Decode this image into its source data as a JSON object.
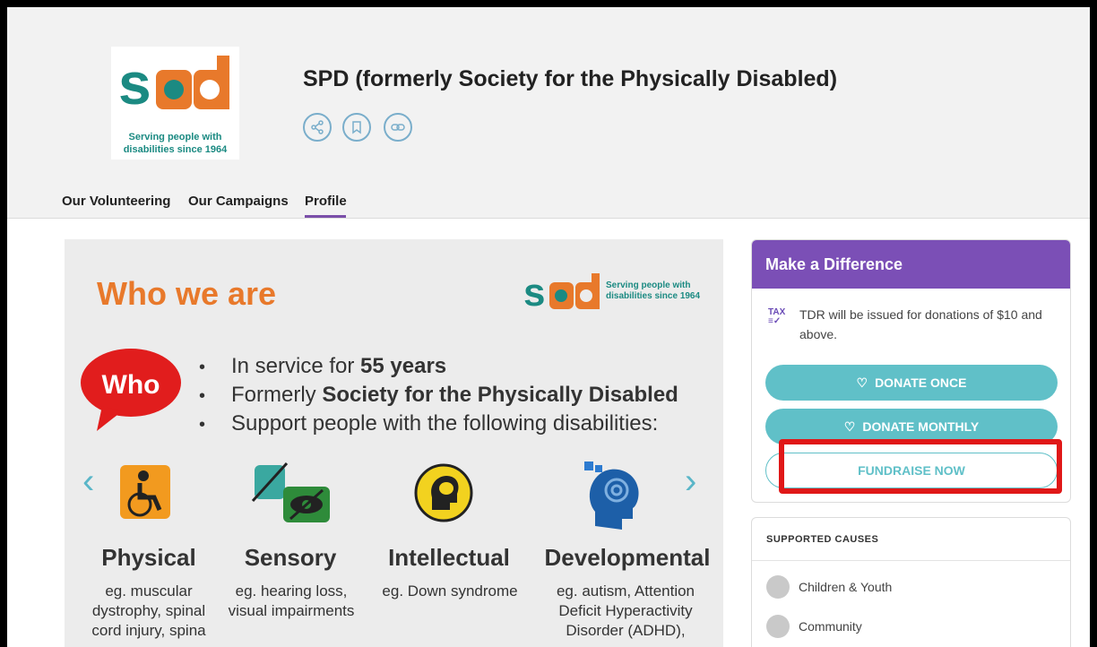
{
  "header": {
    "logo_word": "spd",
    "logo_tagline_1": "Serving people with",
    "logo_tagline_2": "disabilities since 1964",
    "title": "SPD (formerly Society for the Physically Disabled)",
    "actions": [
      "share-icon",
      "bookmark-icon",
      "link-icon"
    ]
  },
  "tabs": [
    {
      "label": "Our Volunteering"
    },
    {
      "label": "Our Campaigns"
    },
    {
      "label": "Profile",
      "active": true
    }
  ],
  "carousel": {
    "heading": "Who we are",
    "logo_tagline_1": "Serving people with",
    "logo_tagline_2": "disabilities since 1964",
    "who_label": "Who",
    "bullets": [
      {
        "prefix": "In service for ",
        "bold": "55 years"
      },
      {
        "prefix": "Formerly ",
        "bold": "Society for the Physically Disabled"
      },
      {
        "prefix": "Support people with the following disabilities:",
        "bold": ""
      }
    ],
    "prev_arrow": "‹",
    "next_arrow": "›",
    "categories": [
      {
        "title": "Physical",
        "desc": [
          "eg. muscular",
          "dystrophy, spinal",
          "cord injury, spina"
        ]
      },
      {
        "title": "Sensory",
        "desc": [
          "eg. hearing loss,",
          "visual impairments"
        ]
      },
      {
        "title": "Intellectual",
        "desc": [
          "eg. Down syndrome"
        ]
      },
      {
        "title": "Developmental",
        "desc": [
          "eg. autism, Attention",
          "Deficit Hyperactivity",
          "Disorder (ADHD),"
        ]
      }
    ]
  },
  "donate": {
    "heading": "Make a Difference",
    "tax_icon": "TAX",
    "tdr_text": "TDR will be issued for donations of $10 and above.",
    "donate_once": "DONATE ONCE",
    "donate_monthly": "DONATE MONTHLY",
    "fundraise": "FUNDRAISE NOW"
  },
  "causes": {
    "title": "SUPPORTED CAUSES",
    "items": [
      {
        "label": "Children & Youth",
        "icon": "children-icon"
      },
      {
        "label": "Community",
        "icon": "community-icon"
      }
    ]
  },
  "colors": {
    "accent_purple": "#7b4fb6",
    "button_teal": "#60c0c8",
    "highlight_red": "#e01818",
    "brand_green": "#1b8a82",
    "brand_orange": "#e8792b"
  }
}
